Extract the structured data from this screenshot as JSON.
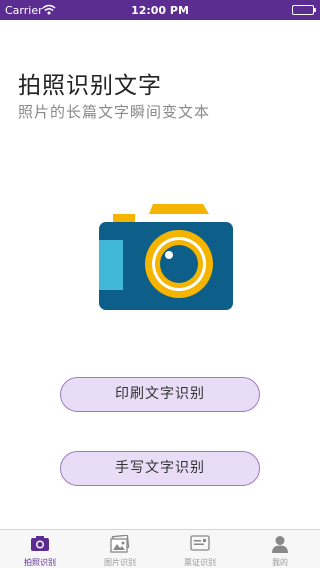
{
  "status_bar": {
    "carrier": "Carrier",
    "time": "12:00 PM"
  },
  "main": {
    "title": "拍照识别文字",
    "subtitle": "照片的长篇文字瞬间变文本",
    "camera_icon": "camera-illustration"
  },
  "actions": {
    "print_label": "印刷文字识别",
    "handwrite_label": "手写文字识别"
  },
  "tab_bar": {
    "active_index": 0,
    "tabs": [
      {
        "label": "拍照识别",
        "icon": "camera-icon"
      },
      {
        "label": "图片识别",
        "icon": "image-icon"
      },
      {
        "label": "票证识别",
        "icon": "id-card-icon"
      },
      {
        "label": "我的",
        "icon": "person-icon"
      }
    ]
  },
  "colors": {
    "accent": "#5c2d91",
    "button_bg": "#e8dcf6",
    "camera_body": "#0d5f8a",
    "camera_lens_ring": "#f4b400",
    "camera_side": "#42b8d8"
  }
}
